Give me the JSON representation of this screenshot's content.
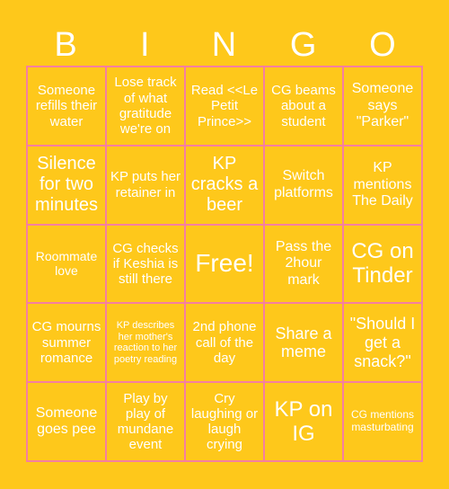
{
  "header": {
    "letters": [
      "B",
      "I",
      "N",
      "G",
      "O"
    ]
  },
  "colors": {
    "background": "#FEC81B",
    "grid_line": "#F57FA0",
    "text": "#FFFFFF"
  },
  "cells": [
    [
      "Someone refills their water",
      "Lose track of what gratitude we're on",
      "Read <<Le Petit Prince>>",
      "CG beams about a student",
      "Someone says \"Parker\""
    ],
    [
      "Silence for two minutes",
      "KP puts her retainer in",
      "KP cracks a beer",
      "Switch platforms",
      "KP mentions The Daily"
    ],
    [
      "Roommate love",
      "CG checks if Keshia is still there",
      "Free!",
      "Pass the 2hour mark",
      "CG on Tinder"
    ],
    [
      "CG mourns summer romance",
      "KP describes her mother's reaction to her poetry reading",
      "2nd phone call of the day",
      "Share a meme",
      "\"Should I get a snack?\""
    ],
    [
      "Someone goes pee",
      "Play by play of mundane event",
      "Cry laughing or laugh crying",
      "KP on IG",
      "CG mentions masturbating"
    ]
  ]
}
